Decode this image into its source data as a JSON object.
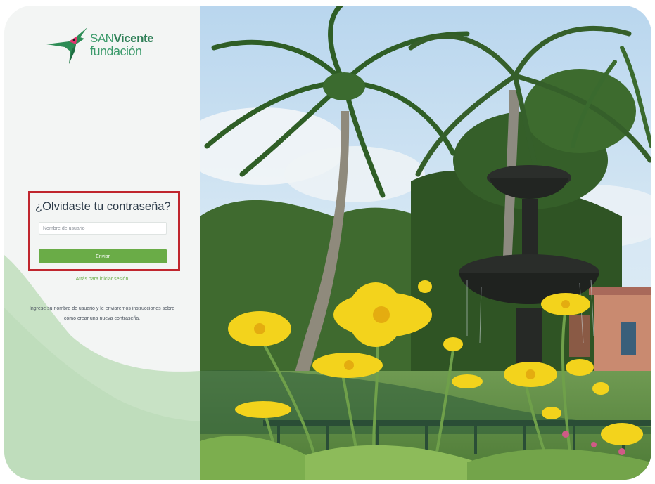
{
  "brand": {
    "line1_light": "SAN",
    "line1_bold": "Vicente",
    "line2": "fundación",
    "logo_icon": "hummingbird-logo",
    "colors": {
      "primary_green": "#6aac47",
      "logo_green": "#3a9a6a",
      "highlight_red": "#c0262e"
    }
  },
  "form": {
    "title": "¿Olvidaste tu contraseña?",
    "username_placeholder": "Nombre de usuario",
    "username_value": "",
    "submit_label": "Enviar"
  },
  "back_link": "Atrás para iniciar sesión",
  "instructions": {
    "line1": "Ingrese su nombre de usuario y le enviaremos instrucciones sobre",
    "line2": "cómo crear una nueva contraseña."
  },
  "background_image": {
    "icon": "palm-fountain-photo"
  }
}
